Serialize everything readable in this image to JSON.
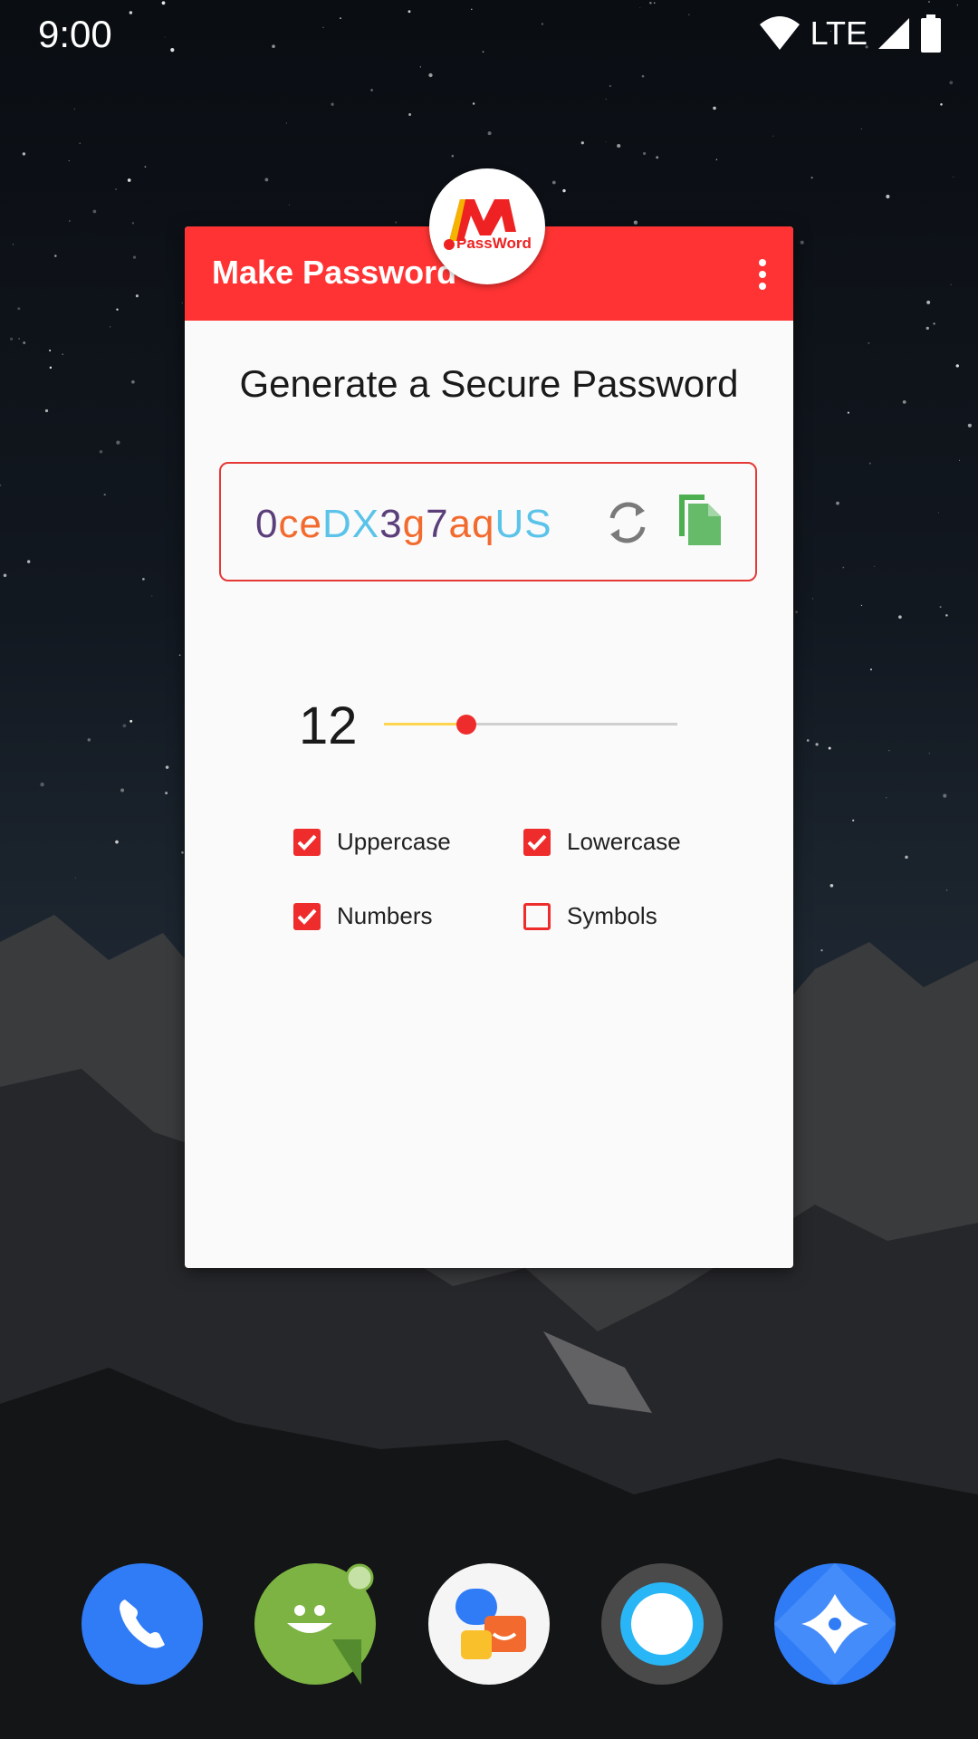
{
  "status_bar": {
    "time": "9:00",
    "network": "LTE"
  },
  "app": {
    "title": "Make Password",
    "logo_text": "PassWord",
    "logo_letter": "M",
    "heading": "Generate a Secure Password",
    "password_segments": [
      {
        "text": "0",
        "color": "#5b3f7a"
      },
      {
        "text": "ce",
        "color": "#f26a2e"
      },
      {
        "text": "DX",
        "color": "#5bc3ea"
      },
      {
        "text": "3",
        "color": "#5b3f7a"
      },
      {
        "text": "g",
        "color": "#f26a2e"
      },
      {
        "text": "7",
        "color": "#5b3f7a"
      },
      {
        "text": "aq",
        "color": "#f26a2e"
      },
      {
        "text": "US",
        "color": "#5bc3ea"
      }
    ],
    "length": "12",
    "slider_fraction": 0.28,
    "options": {
      "uppercase": {
        "label": "Uppercase",
        "checked": true
      },
      "lowercase": {
        "label": "Lowercase",
        "checked": true
      },
      "numbers": {
        "label": "Numbers",
        "checked": true
      },
      "symbols": {
        "label": "Symbols",
        "checked": false
      }
    },
    "accent_color": "#ff3333"
  },
  "dock": [
    "phone-icon",
    "messaging-icon",
    "chat-app-icon",
    "camera-icon",
    "assistant-icon"
  ]
}
